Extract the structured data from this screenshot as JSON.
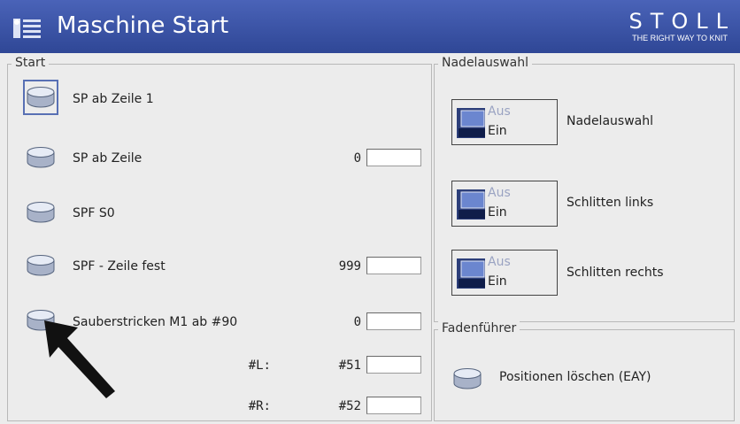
{
  "window": {
    "title": "Maschine Start",
    "brand": {
      "name": "STOLL",
      "tagline": "THE RIGHT WAY TO KNIT"
    }
  },
  "start_group": {
    "label": "Start",
    "options": [
      {
        "label": "SP ab Zeile 1",
        "selected": true
      },
      {
        "label": "SP ab Zeile",
        "value_label": "0",
        "field_value": ""
      },
      {
        "label": "SPF S0"
      },
      {
        "label": "SPF - Zeile fest",
        "value_label": "999",
        "field_value": ""
      },
      {
        "label": "Sauberstricken M1 ab #90",
        "value_label": "0",
        "field_value": ""
      }
    ],
    "extra_rows": [
      {
        "key_label": "#L:",
        "value_label": "#51",
        "field_value": ""
      },
      {
        "key_label": "#R:",
        "value_label": "#52",
        "field_value": ""
      }
    ]
  },
  "needle_group": {
    "label": "Nadelauswahl",
    "toggles": [
      {
        "off_label": "Aus",
        "on_label": "Ein",
        "caption": "Nadelauswahl"
      },
      {
        "off_label": "Aus",
        "on_label": "Ein",
        "caption": "Schlitten links"
      },
      {
        "off_label": "Aus",
        "on_label": "Ein",
        "caption": "Schlitten rechts"
      }
    ]
  },
  "yarn_group": {
    "label": "Fadenführer",
    "action_label": "Positionen löschen (EAY)"
  },
  "colors": {
    "title_bar": "#3a52a6",
    "panel": "#ececec",
    "accent": "#5870b4"
  }
}
